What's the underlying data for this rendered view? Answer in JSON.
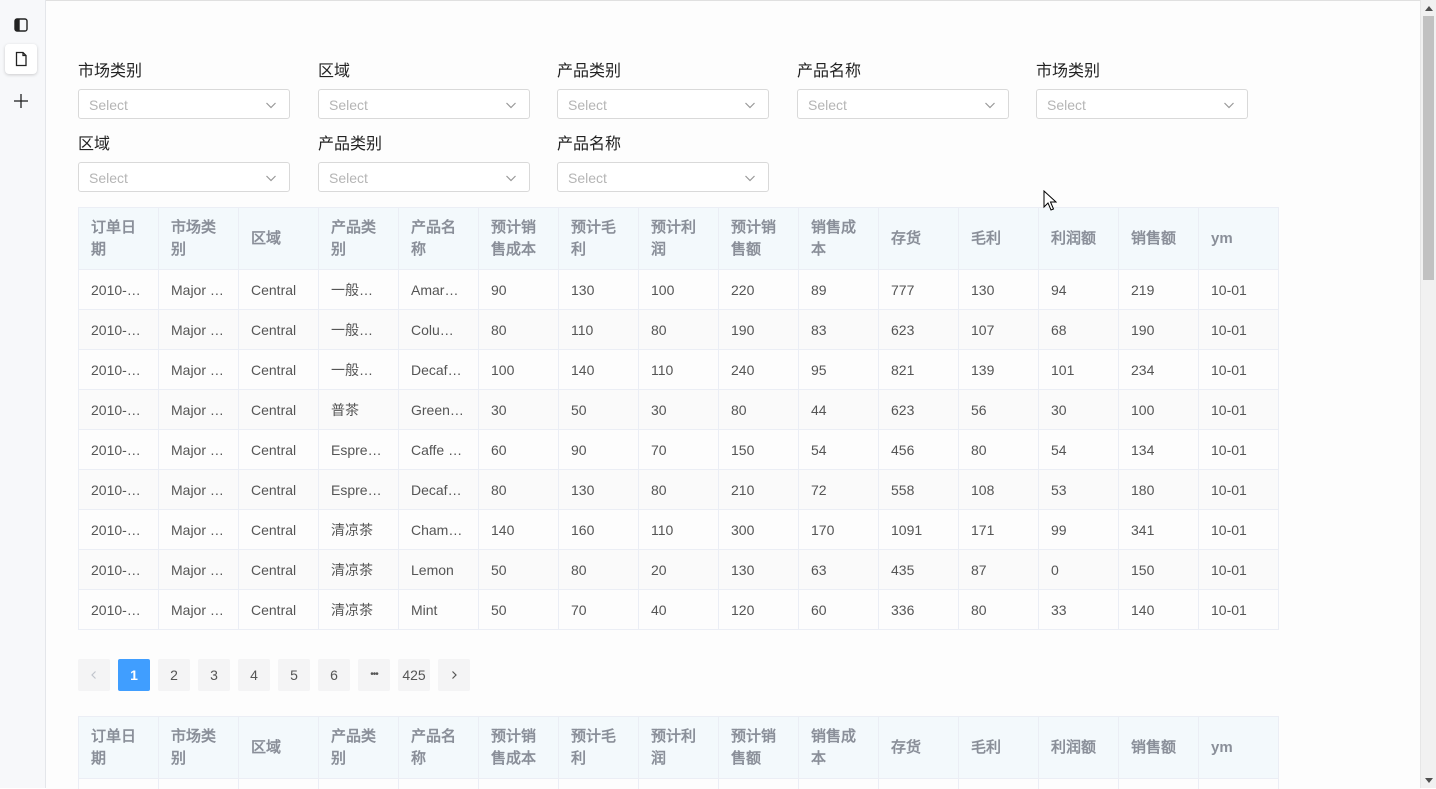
{
  "rail": {
    "items": [
      {
        "icon": "panel-icon"
      },
      {
        "icon": "page-icon"
      },
      {
        "icon": "plus-icon"
      }
    ]
  },
  "filters": [
    {
      "label": "市场类别",
      "placeholder": "Select"
    },
    {
      "label": "区域",
      "placeholder": "Select"
    },
    {
      "label": "产品类别",
      "placeholder": "Select"
    },
    {
      "label": "产品名称",
      "placeholder": "Select"
    },
    {
      "label": "市场类别",
      "placeholder": "Select"
    },
    {
      "label": "区域",
      "placeholder": "Select"
    },
    {
      "label": "产品类别",
      "placeholder": "Select"
    },
    {
      "label": "产品名称",
      "placeholder": "Select"
    }
  ],
  "table": {
    "headers": [
      "订单日期",
      "市场类别",
      "区域",
      "产品类别",
      "产品名称",
      "预计销售成本",
      "预计毛利",
      "预计利润",
      "预计销售额",
      "销售成本",
      "存货",
      "毛利",
      "利润额",
      "销售额",
      "ym"
    ],
    "rows": [
      [
        "2010-…",
        "Major …",
        "Central",
        "一般…",
        "Amar…",
        "90",
        "130",
        "100",
        "220",
        "89",
        "777",
        "130",
        "94",
        "219",
        "10-01"
      ],
      [
        "2010-…",
        "Major …",
        "Central",
        "一般…",
        "Colu…",
        "80",
        "110",
        "80",
        "190",
        "83",
        "623",
        "107",
        "68",
        "190",
        "10-01"
      ],
      [
        "2010-…",
        "Major …",
        "Central",
        "一般…",
        "Decaf…",
        "100",
        "140",
        "110",
        "240",
        "95",
        "821",
        "139",
        "101",
        "234",
        "10-01"
      ],
      [
        "2010-…",
        "Major …",
        "Central",
        "普茶",
        "Green…",
        "30",
        "50",
        "30",
        "80",
        "44",
        "623",
        "56",
        "30",
        "100",
        "10-01"
      ],
      [
        "2010-…",
        "Major …",
        "Central",
        "Espre…",
        "Caffe …",
        "60",
        "90",
        "70",
        "150",
        "54",
        "456",
        "80",
        "54",
        "134",
        "10-01"
      ],
      [
        "2010-…",
        "Major …",
        "Central",
        "Espre…",
        "Decaf…",
        "80",
        "130",
        "80",
        "210",
        "72",
        "558",
        "108",
        "53",
        "180",
        "10-01"
      ],
      [
        "2010-…",
        "Major …",
        "Central",
        "清凉茶",
        "Cham…",
        "140",
        "160",
        "110",
        "300",
        "170",
        "1091",
        "171",
        "99",
        "341",
        "10-01"
      ],
      [
        "2010-…",
        "Major …",
        "Central",
        "清凉茶",
        "Lemon",
        "50",
        "80",
        "20",
        "130",
        "63",
        "435",
        "87",
        "0",
        "150",
        "10-01"
      ],
      [
        "2010-…",
        "Major …",
        "Central",
        "清凉茶",
        "Mint",
        "50",
        "70",
        "40",
        "120",
        "60",
        "336",
        "80",
        "33",
        "140",
        "10-01"
      ]
    ]
  },
  "pagination": {
    "pages": [
      "1",
      "2",
      "3",
      "4",
      "5",
      "6"
    ],
    "ellipsis": "•••",
    "last": "425",
    "current": "1"
  },
  "colors": {
    "accent": "#409eff",
    "header_bg": "#f3f9fc"
  }
}
